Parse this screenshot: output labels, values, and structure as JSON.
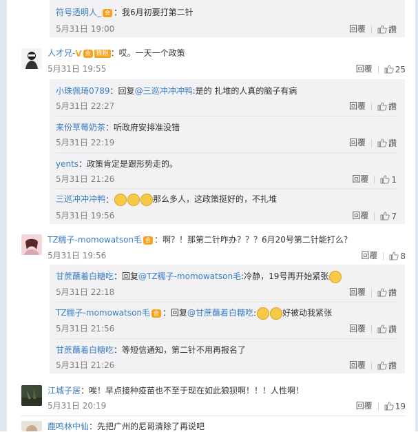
{
  "actions": {
    "reply": "回覆",
    "like_word": "讚"
  },
  "comments": [
    {
      "user": "符号透明人_",
      "text": "：我6月初要打第二针",
      "time": "5月31日 19:00",
      "like": ""
    },
    {
      "user": "人才兄-",
      "fan_badge": "铁粉",
      "text": "：哎。一天一个政策",
      "time": "5月31日 19:55",
      "like": "25"
    },
    {
      "user": "小珠佩琦0789",
      "reply_prefix": "：回复",
      "reply_to": "@三巡冲冲冲鸭",
      "text": ":是的 扎堆的人真的脑子有病",
      "time": "5月31日 22:27",
      "like": ""
    },
    {
      "user": "来份草莓奶茶",
      "text": "：听政府安排准没错",
      "time": "5月31日 22:19",
      "like": ""
    },
    {
      "user": "yents",
      "text": "：政策肯定是跟形势走的。",
      "time": "5月31日 21:26",
      "like": "1"
    },
    {
      "user": "三巡冲冲冲鸭",
      "text": "那么多人，这政策挺好的，不扎堆",
      "time": "5月31日 19:56",
      "like": "7"
    },
    {
      "user": "TZ糯子-momowatson毛",
      "text": "：啊？！那第二针咋办？？？6月20号第二针能打么？",
      "time": "5月31日 19:56",
      "like": "8"
    },
    {
      "user": "甘蔗蘸着白糖吃",
      "reply_prefix": "：回复",
      "reply_to": "@TZ糯子-momowatson毛",
      "text": ":冷静，19号再开始紧张",
      "time": "5月31日 22:18",
      "like": ""
    },
    {
      "user": "TZ糯子-momowatson毛",
      "reply_prefix": "：回复",
      "reply_to": "@甘蔗蘸着白糖吃",
      "text": "好被动我紧张",
      "time": "5月31日 21:56",
      "like": ""
    },
    {
      "user": "甘蔗蘸着白糖吃",
      "text": "：等短信通知，第二针不用再报名了",
      "time": "5月31日 21:26",
      "like": ""
    },
    {
      "user": "江城子居",
      "text": "：唉！早点接种疫苗也不至于现在如此狼狈啊！！！人性啊！",
      "time": "5月31日 20:19",
      "like": "19"
    },
    {
      "user": "鹿鸣林中仙",
      "text": "：先把广州的尼哥清除了再说吧",
      "time": "",
      "like": ""
    }
  ],
  "colors": {
    "username": "#eb7350",
    "link": "#3a7ec2",
    "sub_bg": "#f2f2f5"
  }
}
